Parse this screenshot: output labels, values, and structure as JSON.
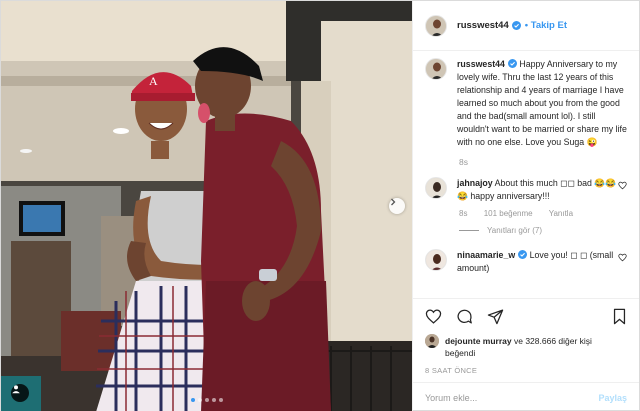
{
  "post": {
    "author": "russwest44",
    "follow_label": "Takip Et",
    "caption": "Happy Anniversary to my lovely wife. Thru the last 12 years of this relationship and 4 years of marriage I have learned so much about you from the good and the bad(small amount lol). I still wouldn't want to be married or share my life with no one else. Love you Suga 😜",
    "caption_time": "8s",
    "comments": [
      {
        "user": "jahnajoy",
        "verified": false,
        "text": "About this much ◻︎◻︎ bad 😂😂😂 happy anniversary!!!",
        "time": "8s",
        "likes": "101 beğenme",
        "reply_label": "Yanıtla",
        "view_replies": "Yanıtları gör (7)"
      },
      {
        "user": "ninaamarie_w",
        "verified": true,
        "text": "Love you! ◻︎ ◻︎ (small amount)"
      }
    ],
    "liked_by_user": "dejounte murray",
    "liked_by_rest": "ve 328.666 diğer kişi",
    "liked_by_line2": "beğendi",
    "time_ago": "8 SAAT ÖNCE",
    "comment_placeholder": "Yorum ekle...",
    "post_button": "Paylaş"
  },
  "colors": {
    "link_blue": "#3897f0",
    "disabled_blue": "#b2dffc",
    "verified_blue": "#3897f0"
  },
  "icons": [
    "verified-icon",
    "next-arrow-icon",
    "user-tag-icon",
    "heart-icon",
    "comment-icon",
    "share-icon",
    "bookmark-icon"
  ],
  "carousel": {
    "slides": 5,
    "active": 1
  }
}
